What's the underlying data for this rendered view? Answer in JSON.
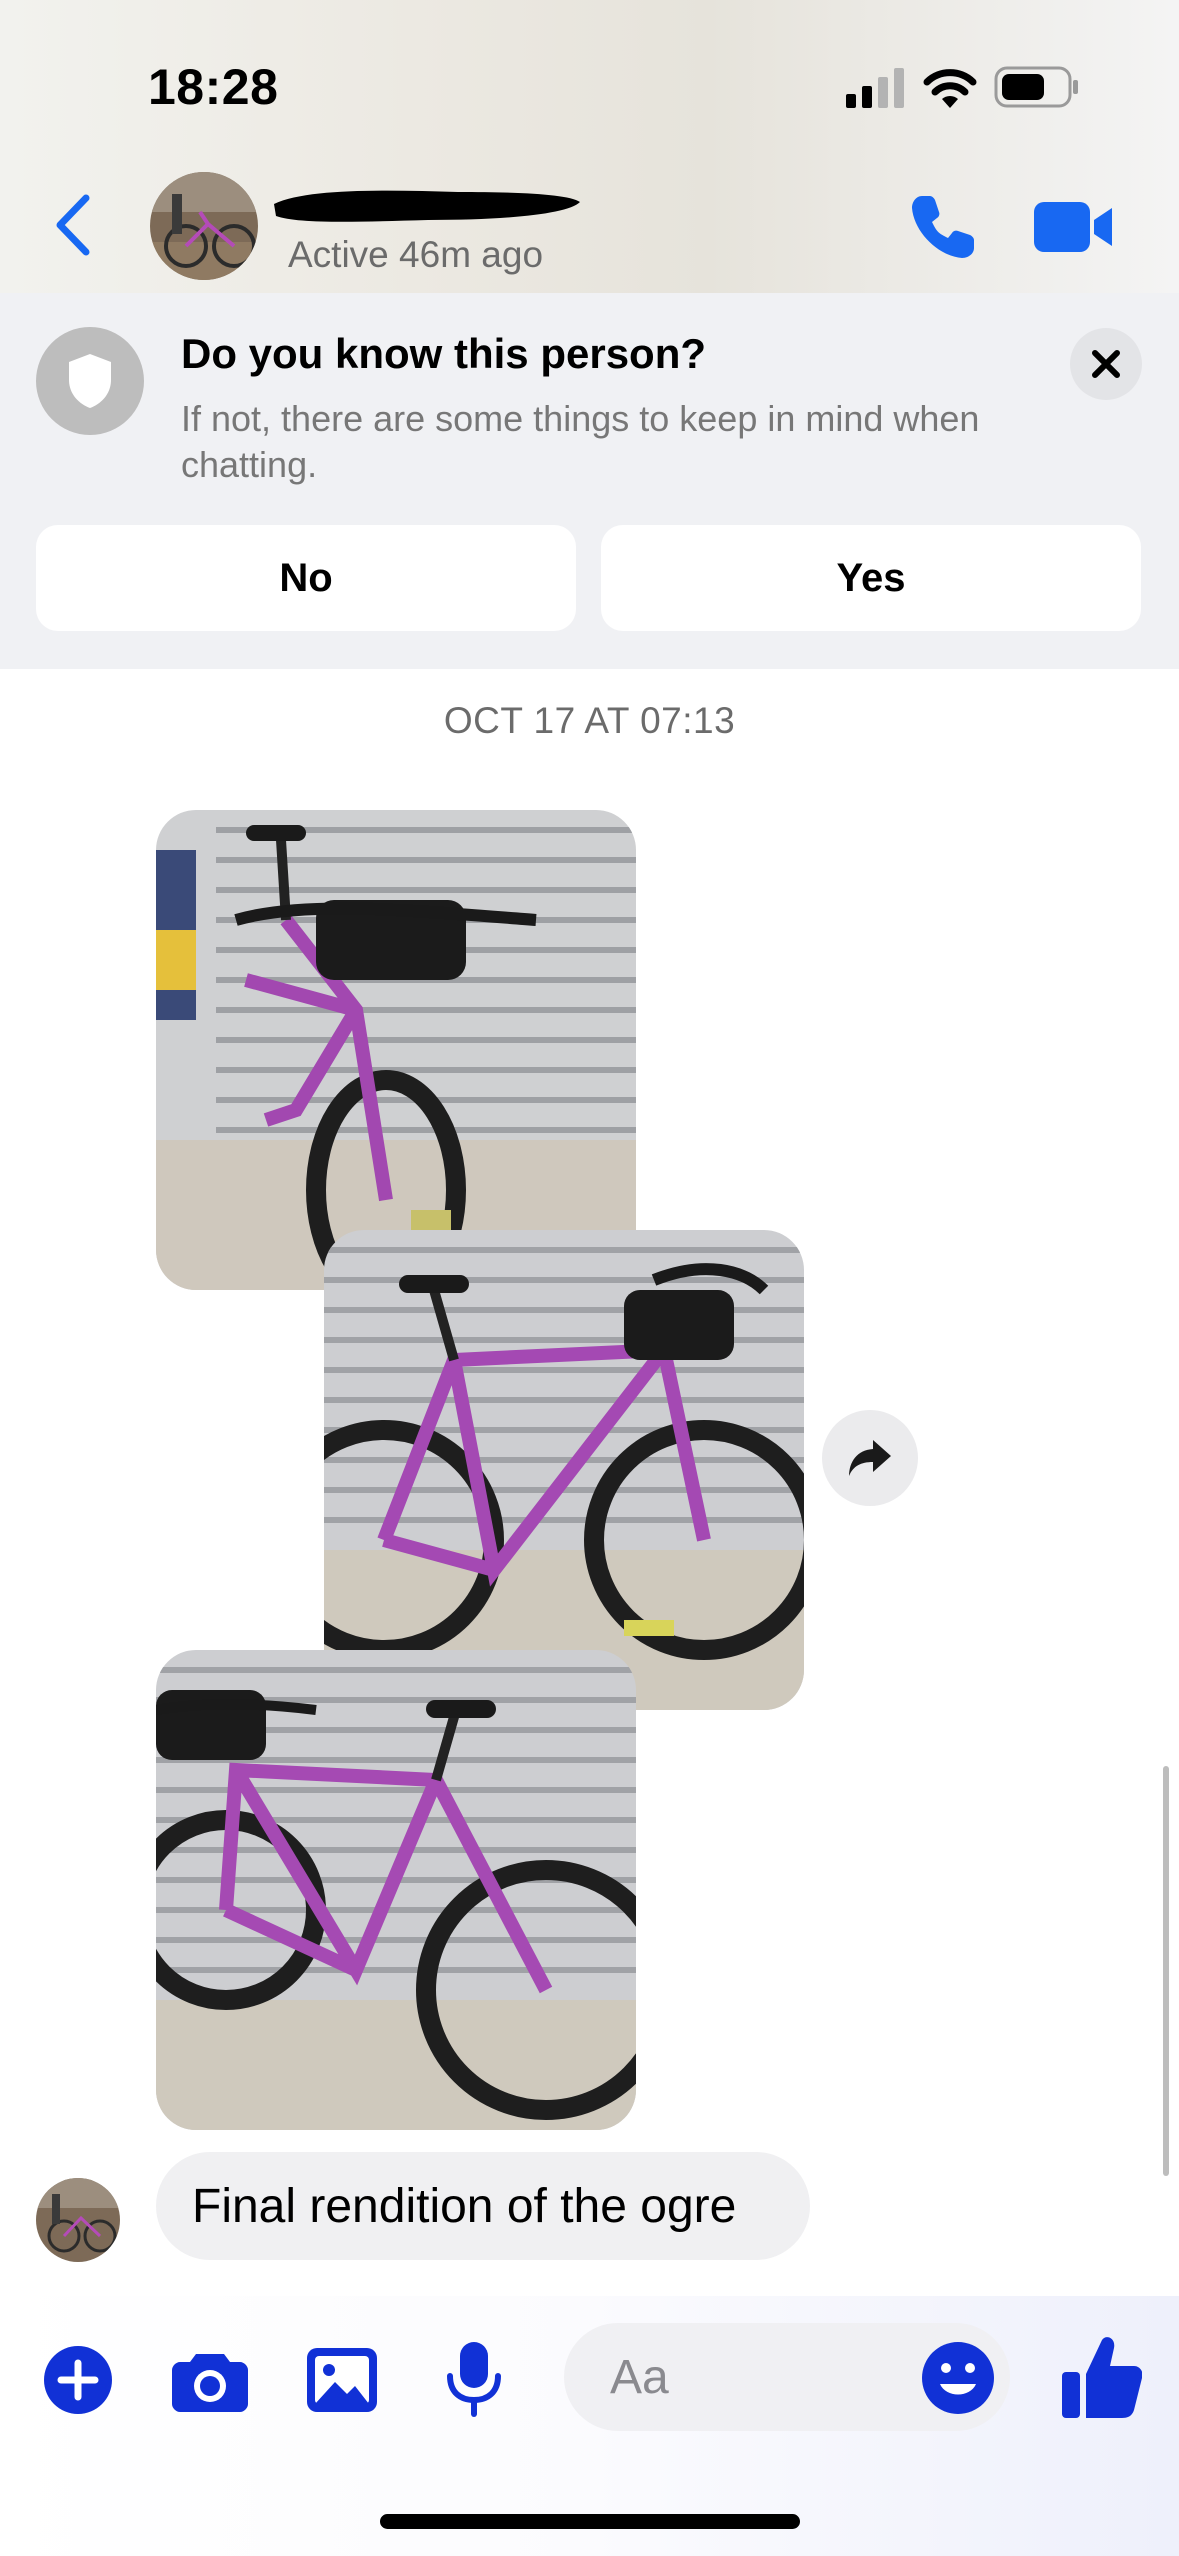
{
  "status_bar": {
    "time": "18:28"
  },
  "header": {
    "active_status": "Active 46m ago",
    "icons": [
      "back-chevron-icon",
      "phone-icon",
      "video-camera-icon"
    ],
    "accent_color": "#1868f2"
  },
  "safety_banner": {
    "title": "Do you know this person?",
    "description": "If not, there are some things to keep in mind when chatting.",
    "no_label": "No",
    "yes_label": "Yes"
  },
  "conversation": {
    "timestamp": "OCT 17 AT 07:13",
    "photo_count": 3,
    "message": "Final rendition of the ogre"
  },
  "composer": {
    "placeholder": "Aa",
    "tools": [
      "plus-icon",
      "camera-icon",
      "gallery-icon",
      "microphone-icon",
      "emoji-icon",
      "thumbs-up-icon"
    ],
    "tool_color": "#1131d6"
  }
}
